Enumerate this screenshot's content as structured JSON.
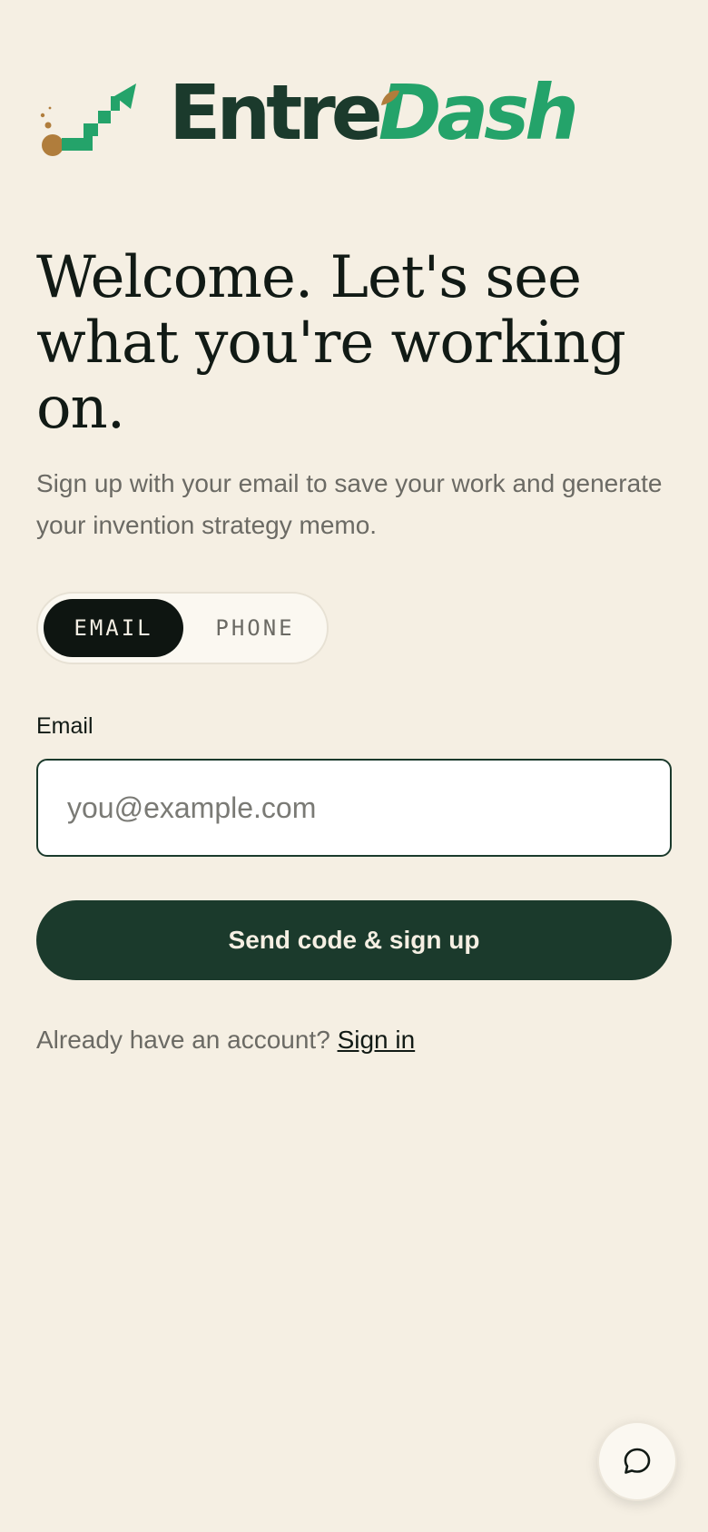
{
  "brand": {
    "name_part1": "Entre",
    "name_part2": "Dash",
    "colors": {
      "dark_green": "#1b3a2c",
      "accent_green": "#24a36a",
      "accent_gold": "#b07d3c",
      "background": "#f5efe3"
    }
  },
  "hero": {
    "headline": "Welcome. Let's see what you're working on.",
    "subtitle": "Sign up with your email to save your work and generate your invention strategy memo."
  },
  "auth_toggle": {
    "options": [
      {
        "label": "EMAIL",
        "selected": true
      },
      {
        "label": "PHONE",
        "selected": false
      }
    ]
  },
  "form": {
    "email_label": "Email",
    "email_placeholder": "you@example.com",
    "email_value": "",
    "submit_label": "Send code & sign up"
  },
  "footer": {
    "prompt": "Already have an account?",
    "signin_link": "Sign in"
  },
  "icons": {
    "logo": "rising-stairs-logo-icon",
    "chat": "chat-bubble-icon"
  }
}
